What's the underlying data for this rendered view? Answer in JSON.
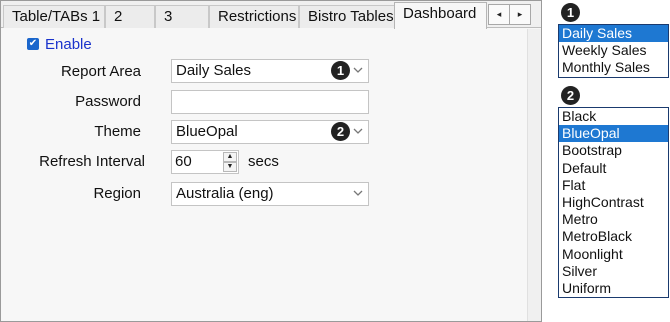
{
  "tabs": [
    {
      "label": "Table/TABs 1",
      "active": false
    },
    {
      "label": "2",
      "active": false
    },
    {
      "label": "3",
      "active": false
    },
    {
      "label": "Restrictions",
      "active": false
    },
    {
      "label": "Bistro Tables",
      "active": false
    },
    {
      "label": "Dashboard",
      "active": true
    }
  ],
  "tab_scroll": {
    "left": "◂",
    "right": "▸"
  },
  "enable": {
    "checked": true,
    "check_glyph": "✔",
    "label": "Enable"
  },
  "form": {
    "report_area": {
      "label": "Report Area",
      "value": "Daily Sales",
      "callout": "1"
    },
    "password": {
      "label": "Password",
      "value": ""
    },
    "theme": {
      "label": "Theme",
      "value": "BlueOpal",
      "callout": "2"
    },
    "refresh_interval": {
      "label": "Refresh Interval",
      "value": "60",
      "unit": "secs",
      "spin_up": "▲",
      "spin_down": "▼"
    },
    "region": {
      "label": "Region",
      "value": "Australia (eng)"
    }
  },
  "report_area_options": {
    "callout": "1",
    "items": [
      "Daily Sales",
      "Weekly Sales",
      "Monthly Sales"
    ],
    "selected": "Daily Sales"
  },
  "theme_options": {
    "callout": "2",
    "items": [
      "Black",
      "BlueOpal",
      "Bootstrap",
      "Default",
      "Flat",
      "HighContrast",
      "Metro",
      "MetroBlack",
      "Moonlight",
      "Silver",
      "Uniform"
    ],
    "selected": "BlueOpal"
  },
  "colors": {
    "selection": "#1e78d2",
    "link_blue": "#1a33cc",
    "checkbox": "#1a66cc",
    "badge": "#222222"
  }
}
